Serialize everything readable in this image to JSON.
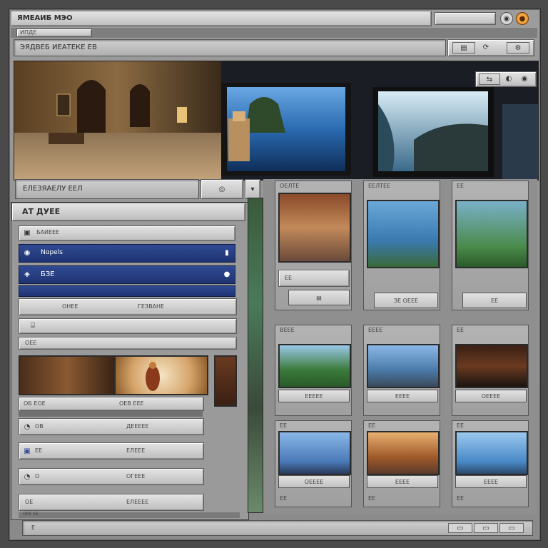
{
  "window": {
    "title": "ЯМЕАИБ МЭО"
  },
  "menubar": {
    "label": "ИПДЕ"
  },
  "toolbar": {
    "address": "ЭЯДВЕБ ИЕАТЕКЕ ЕВ"
  },
  "hero": {
    "controls": [
      "⇆",
      "◐",
      "◉"
    ]
  },
  "left_panel": {
    "search_label": "ЕЛЕЗЯАЕЛУ ЕЕЛ",
    "header": "АТ ДУЕЕ",
    "rows": [
      {
        "label": "БАИЕЕЕ"
      },
      {
        "label": "Nɑpels"
      },
      {
        "label": "БЗЕ"
      }
    ],
    "action_label": "ОНЕЕ",
    "action_right": "ГЕЗВАНЕ",
    "section_label": "ОЕЕ",
    "list": [
      {
        "left": "ОБ ЕОЕ",
        "right": "ОЕВ ЕЕЕ"
      },
      {
        "left": "ОВ",
        "right": "ДЕЕЕЕЕ"
      },
      {
        "left": "ЕЕ",
        "right": "ЕЛЕЕЕ"
      },
      {
        "left": "О",
        "right": "ОГЕЕЕ"
      },
      {
        "left": "ОЕ",
        "right": "ЕЛЕЕЕЕ"
      }
    ],
    "footer": "ОЕЕ ЕЕ"
  },
  "grid": {
    "row1": [
      {
        "title": "ОЕЛТЕ",
        "caption": "ЕЕ"
      },
      {
        "title": "ЕЕЛТЕЕ",
        "caption": "ЗЕ ОЕЕЕ"
      },
      {
        "title": "ЕЕ",
        "caption": "ЕЕ"
      }
    ],
    "row2": [
      {
        "title": "ВЕЕЕ",
        "caption": "ЕЕЕЕЕ"
      },
      {
        "title": "ЕЕЕЕ",
        "caption": "ЕЕЕЕ"
      },
      {
        "title": "ЕЕ",
        "caption": "ОЕЕЕЕ"
      }
    ],
    "row3": [
      {
        "title": "ЕЕ",
        "caption": "ОЕЕЕЕ"
      },
      {
        "title": "ЕЕ",
        "caption": "ЕЕЕЕ"
      },
      {
        "title": "ЕЕ",
        "caption": "ЕЕЕЕ"
      }
    ],
    "row3_footer": [
      "ЕЕ",
      "ЕЕ",
      "ЕЕ"
    ]
  },
  "statusbar": {
    "left": "Е"
  },
  "colors": {
    "accent_blue": "#2f4a93",
    "close_orange": "#e07a1e"
  }
}
